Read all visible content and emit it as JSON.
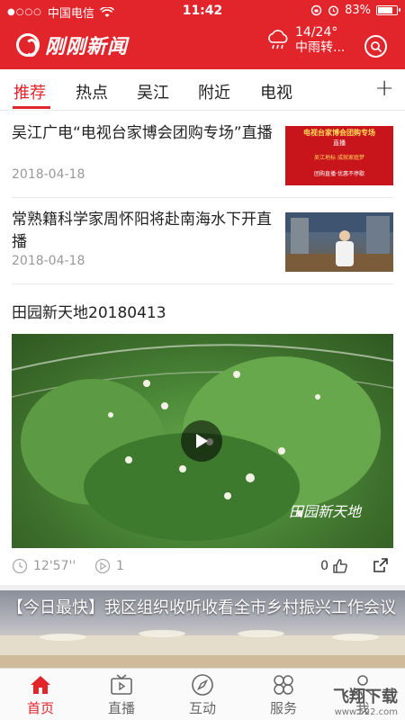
{
  "status_bar": {
    "carrier": "中国电信",
    "time": "11:42",
    "battery": "83%",
    "battery_level": 0.83
  },
  "header": {
    "logo_text": "刚刚新闻",
    "weather_temp": "14/24°",
    "weather_desc": "中雨转...",
    "accent_color": "#e2242b"
  },
  "tabs": [
    {
      "label": "推荐",
      "active": true
    },
    {
      "label": "热点",
      "active": false
    },
    {
      "label": "吴江",
      "active": false
    },
    {
      "label": "附近",
      "active": false
    },
    {
      "label": "电视",
      "active": false
    }
  ],
  "news": [
    {
      "title": "吴江广电“电视台家博会团购专场”直播",
      "date": "2018-04-18",
      "thumb_text": [
        "电视台家博会团购专场",
        "直播",
        "吴江地标 成就家庭梦",
        "团购直播·优惠不停歇"
      ]
    },
    {
      "title": "常熟籍科学家周怀阳将赴南海水下开直播",
      "date": "2018-04-18"
    }
  ],
  "video": {
    "title": "田园新天地20180413",
    "caption": "田园新天地",
    "duration": "12'57''",
    "plays": "1",
    "likes": "0"
  },
  "banner": {
    "text": "【今日最快】我区组织收听收看全市乡村振兴工作会议"
  },
  "bottom_nav": [
    {
      "label": "首页",
      "icon": "home-icon",
      "active": true
    },
    {
      "label": "直播",
      "icon": "tv-icon",
      "active": false
    },
    {
      "label": "互动",
      "icon": "compass-icon",
      "active": false
    },
    {
      "label": "服务",
      "icon": "grid-icon",
      "active": false
    },
    {
      "label": "我",
      "icon": "user-icon",
      "active": false
    }
  ],
  "watermark": {
    "text": "飞翔下载",
    "sub": "www.522.com"
  }
}
